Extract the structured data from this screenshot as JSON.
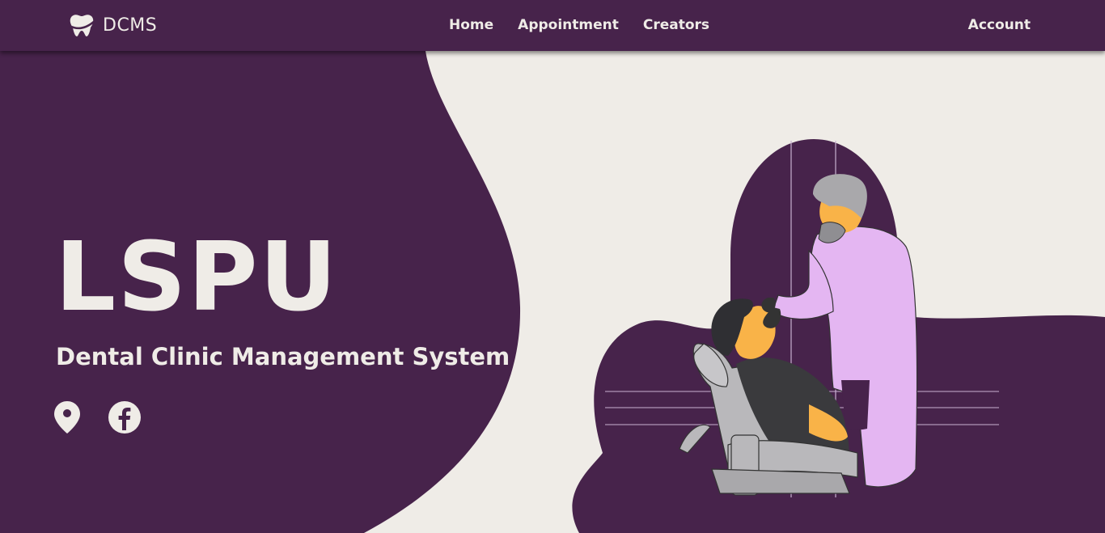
{
  "navbar": {
    "brand": {
      "icon": "tooth-icon",
      "name": "DCMS"
    },
    "links": [
      {
        "label": "Home"
      },
      {
        "label": "Appointment"
      },
      {
        "label": "Creators"
      }
    ],
    "account_label": "Account"
  },
  "hero": {
    "title": "LSPU",
    "subtitle": "Dental Clinic Management System",
    "social_icons": [
      "location-pin-icon",
      "facebook-icon"
    ]
  },
  "colors": {
    "primary": "#47234b",
    "background": "#efece7",
    "text_light": "#efece7",
    "coat": "#e4b6f2",
    "skin": "#f9b348",
    "chair": "#b9b8bb"
  }
}
